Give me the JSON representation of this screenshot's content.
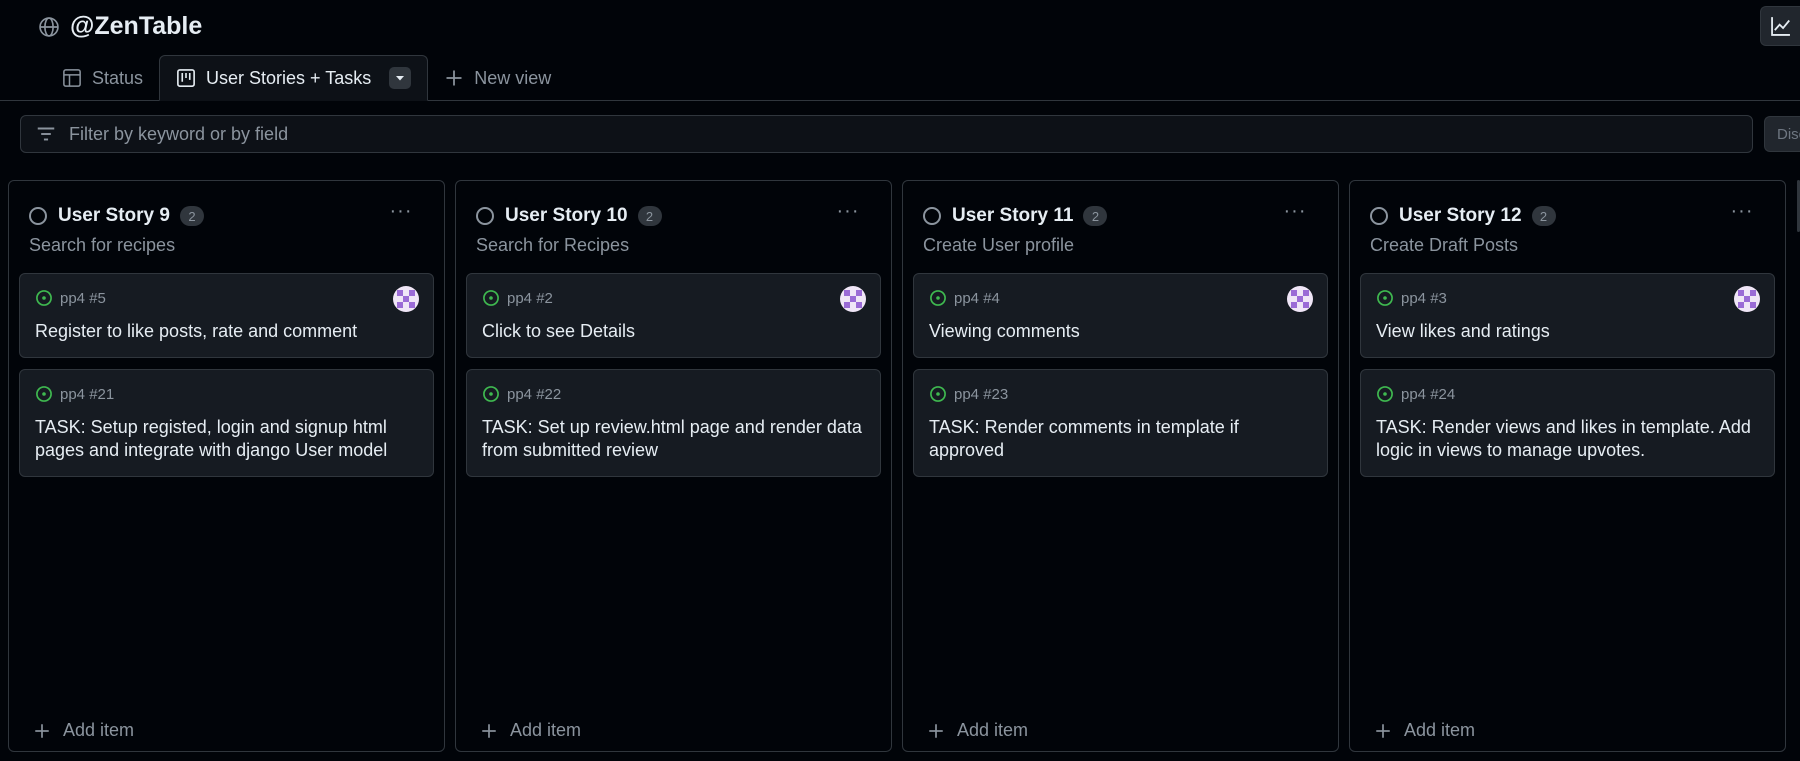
{
  "header": {
    "title": "@ZenTable",
    "globe_icon": "globe-icon",
    "insights_icon": "graph-icon"
  },
  "tabs": [
    {
      "label": "Status",
      "icon": "table-icon",
      "active": false
    },
    {
      "label": "User Stories + Tasks",
      "icon": "board-icon",
      "active": true
    }
  ],
  "new_view": {
    "label": "New view"
  },
  "filter": {
    "placeholder": "Filter by keyword or by field",
    "value": ""
  },
  "discard": {
    "label": "Disc"
  },
  "columns": [
    {
      "title": "User Story 9",
      "count": "2",
      "description": "Search for recipes",
      "cards": [
        {
          "ref": "pp4 #5",
          "text": "Register to like posts, rate and comment",
          "has_avatar": true
        },
        {
          "ref": "pp4 #21",
          "text": "TASK: Setup registed, login and signup html pages and integrate with django User model",
          "has_avatar": false
        }
      ],
      "add_label": "Add item"
    },
    {
      "title": "User Story 10",
      "count": "2",
      "description": "Search for Recipes",
      "cards": [
        {
          "ref": "pp4 #2",
          "text": "Click to see Details",
          "has_avatar": true
        },
        {
          "ref": "pp4 #22",
          "text": "TASK: Set up review.html page and render data from submitted review",
          "has_avatar": false
        }
      ],
      "add_label": "Add item"
    },
    {
      "title": "User Story 11",
      "count": "2",
      "description": "Create User profile",
      "cards": [
        {
          "ref": "pp4 #4",
          "text": "Viewing comments",
          "has_avatar": true
        },
        {
          "ref": "pp4 #23",
          "text": "TASK: Render comments in template if approved",
          "has_avatar": false
        }
      ],
      "add_label": "Add item"
    },
    {
      "title": "User Story 12",
      "count": "2",
      "description": "Create Draft Posts",
      "cards": [
        {
          "ref": "pp4 #3",
          "text": "View likes and ratings",
          "has_avatar": true
        },
        {
          "ref": "pp4 #24",
          "text": "TASK: Render views and likes in template. Add logic in views to manage upvotes.",
          "has_avatar": false
        }
      ],
      "add_label": "Add item"
    }
  ],
  "colors": {
    "background": "#010409",
    "card": "#161b22",
    "border": "#30363d",
    "open_issue": "#3fb950",
    "muted": "#8b949e"
  }
}
